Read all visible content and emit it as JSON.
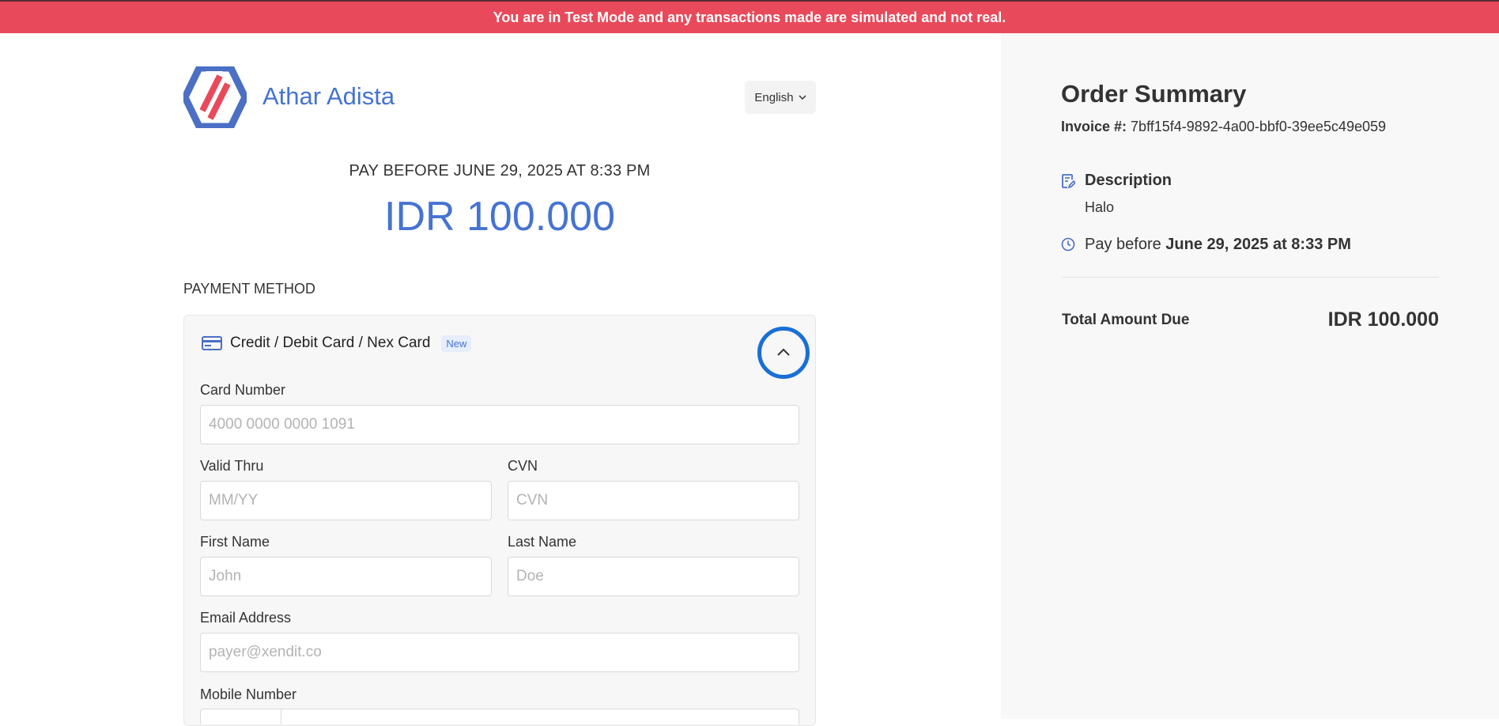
{
  "banner": {
    "text": "You are in Test Mode and any transactions made are simulated and not real."
  },
  "merchant": {
    "name": "Athar Adista"
  },
  "language": {
    "selected": "English"
  },
  "payment": {
    "pay_before": "PAY BEFORE JUNE 29, 2025 AT 8:33 PM",
    "amount": "IDR 100.000",
    "method_title": "PAYMENT METHOD",
    "card_method": {
      "title": "Credit / Debit Card / Nex Card",
      "badge": "New"
    }
  },
  "form": {
    "card_number": {
      "label": "Card Number",
      "placeholder": "4000 0000 0000 1091"
    },
    "valid_thru": {
      "label": "Valid Thru",
      "placeholder": "MM/YY"
    },
    "cvn": {
      "label": "CVN",
      "placeholder": "CVN"
    },
    "first_name": {
      "label": "First Name",
      "placeholder": "John"
    },
    "last_name": {
      "label": "Last Name",
      "placeholder": "Doe"
    },
    "email": {
      "label": "Email Address",
      "placeholder": "payer@xendit.co"
    },
    "mobile": {
      "label": "Mobile Number"
    }
  },
  "summary": {
    "title": "Order Summary",
    "invoice_label": "Invoice #:",
    "invoice_value": "7bff15f4-9892-4a00-bbf0-39ee5c49e059",
    "description_title": "Description",
    "description_value": "Halo",
    "pay_before_prefix": "Pay before",
    "pay_before_value": "June 29, 2025 at 8:33 PM",
    "total_label": "Total Amount Due",
    "total_value": "IDR 100.000"
  },
  "colors": {
    "banner": "#e84a5b",
    "accent": "#4573d2",
    "logo_red": "#e84a5b",
    "annotation_circle": "#1a6fd6"
  },
  "icons": [
    "logo-icon",
    "chevron-down-icon",
    "credit-card-icon",
    "chevron-up-icon",
    "document-edit-icon",
    "clock-icon"
  ]
}
